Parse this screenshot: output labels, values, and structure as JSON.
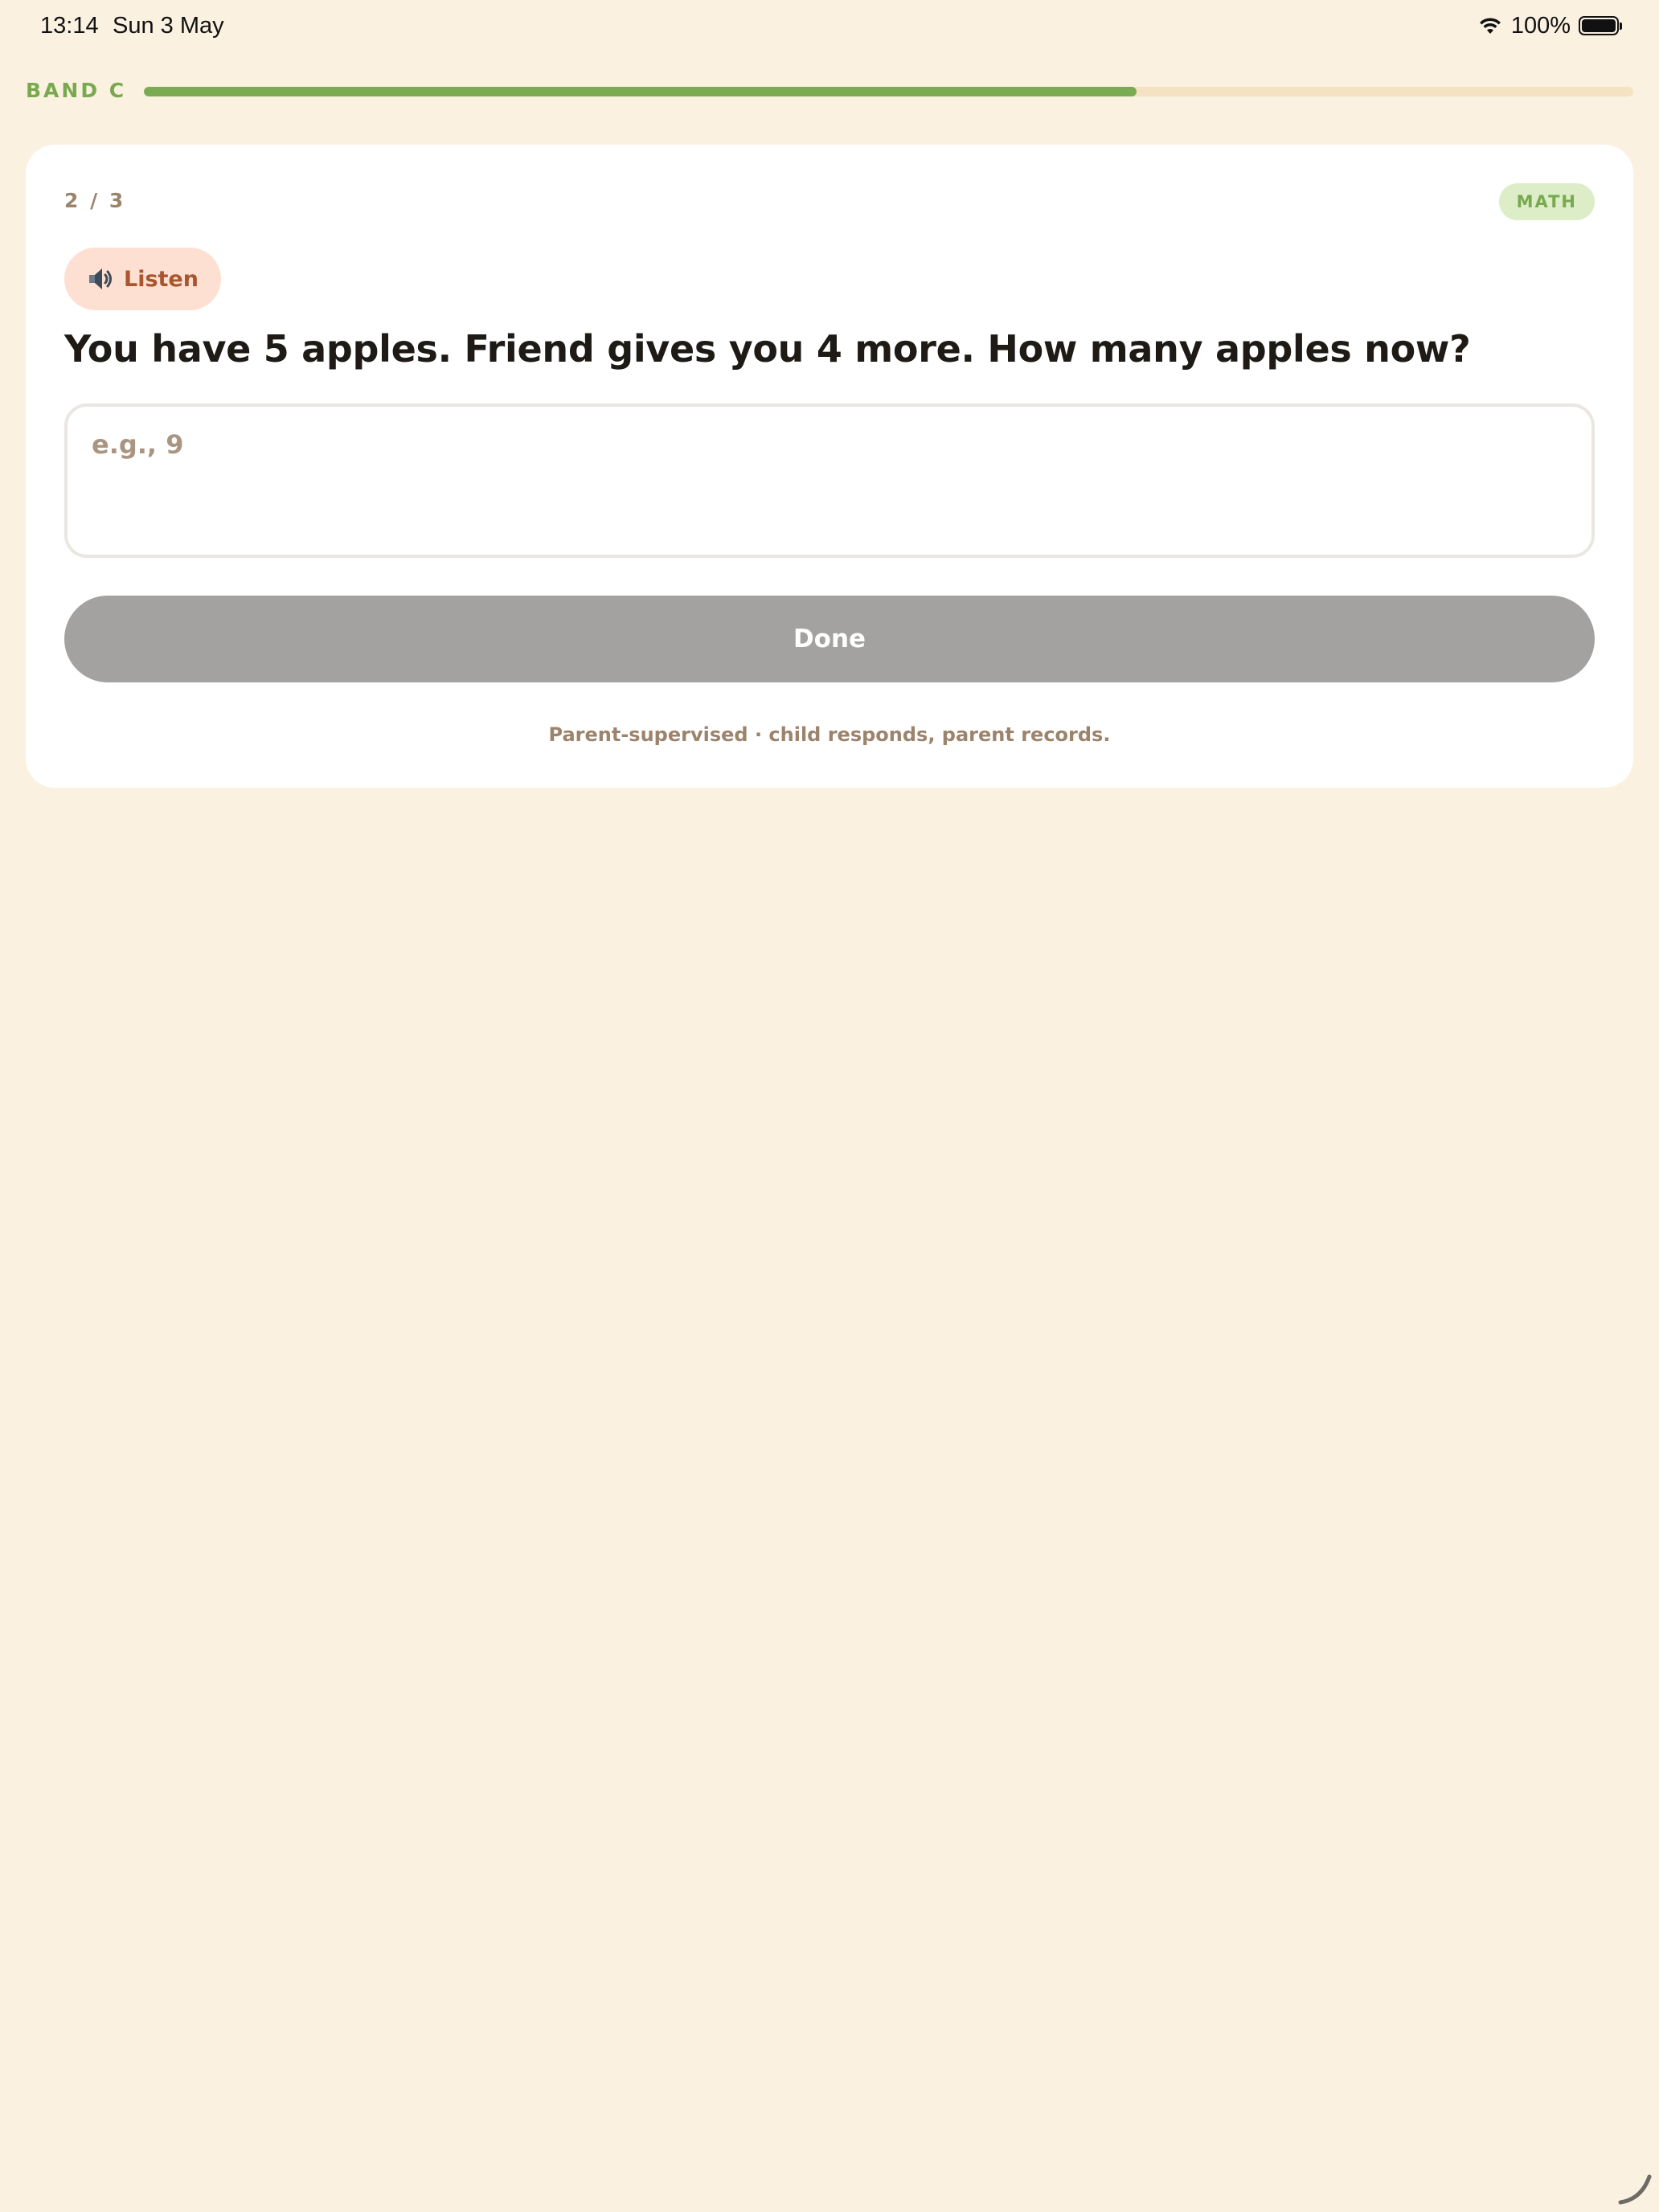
{
  "status_bar": {
    "time": "13:14",
    "date": "Sun 3 May",
    "battery_percent": "100%",
    "battery_level": 1.0,
    "icons": [
      "wifi-icon",
      "battery-icon"
    ]
  },
  "band": {
    "label": "BAND C",
    "progress_fraction": 0.6667,
    "progress_color": "#7AAA52",
    "track_color": "#F4E2C3"
  },
  "card": {
    "counter": "2 / 3",
    "subject_badge": "MATH",
    "listen_button": {
      "icon": "speaker-icon",
      "label": "Listen"
    },
    "question": "You have 5 apples. Friend gives you 4 more. How many apples now?",
    "answer_input": {
      "value": "",
      "placeholder": "e.g., 9"
    },
    "done_button": {
      "label": "Done",
      "state": "disabled"
    },
    "footer_note": "Parent-supervised · child responds, parent records."
  },
  "colors": {
    "background": "#FAF1E1",
    "accent_green": "#79A94E",
    "listen_bg": "#FDE0D2",
    "listen_text": "#A9552F",
    "done_disabled": "#A3A2A0"
  }
}
